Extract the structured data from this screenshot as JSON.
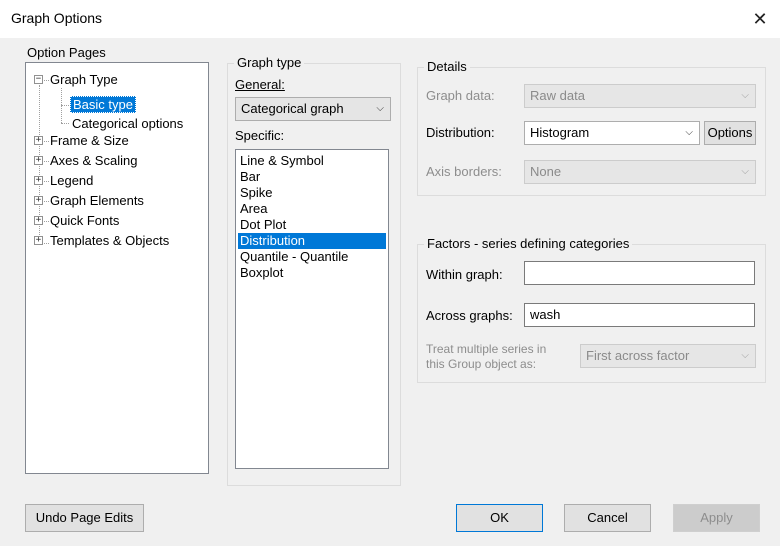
{
  "window": {
    "title": "Graph Options",
    "close_glyph": "✕"
  },
  "option_pages": {
    "label": "Option Pages",
    "items": [
      {
        "label": "Graph Type",
        "expander": "−"
      },
      {
        "label": "Basic type"
      },
      {
        "label": "Categorical options"
      },
      {
        "label": "Frame & Size",
        "expander": "+"
      },
      {
        "label": "Axes & Scaling",
        "expander": "+"
      },
      {
        "label": "Legend",
        "expander": "+"
      },
      {
        "label": "Graph Elements",
        "expander": "+"
      },
      {
        "label": "Quick Fonts",
        "expander": "+"
      },
      {
        "label": "Templates & Objects",
        "expander": "+"
      }
    ]
  },
  "graph_type": {
    "label": "Graph type",
    "general_label": "General:",
    "general_value": "Categorical graph",
    "specific_label": "Specific:",
    "specific_items": [
      "Line & Symbol",
      "Bar",
      "Spike",
      "Area",
      "Dot Plot",
      "Distribution",
      "Quantile - Quantile",
      "Boxplot"
    ],
    "selected": "Distribution"
  },
  "details": {
    "label": "Details",
    "graph_data_label": "Graph data:",
    "graph_data_value": "Raw data",
    "distribution_label": "Distribution:",
    "distribution_value": "Histogram",
    "options_button": "Options",
    "axis_borders_label": "Axis borders:",
    "axis_borders_value": "None"
  },
  "factors": {
    "label": "Factors - series defining categories",
    "within_label": "Within graph:",
    "within_value": "",
    "across_label": "Across graphs:",
    "across_value": "wash",
    "treat_label_1": "Treat multiple series in",
    "treat_label_2": "this Group object as:",
    "treat_value": "First across factor"
  },
  "buttons": {
    "undo": "Undo Page Edits",
    "ok": "OK",
    "cancel": "Cancel",
    "apply": "Apply"
  },
  "icons": {
    "dropdown": "chevron-down-icon",
    "close": "close-icon",
    "collapse": "minus-box-icon",
    "expand": "plus-box-icon"
  }
}
